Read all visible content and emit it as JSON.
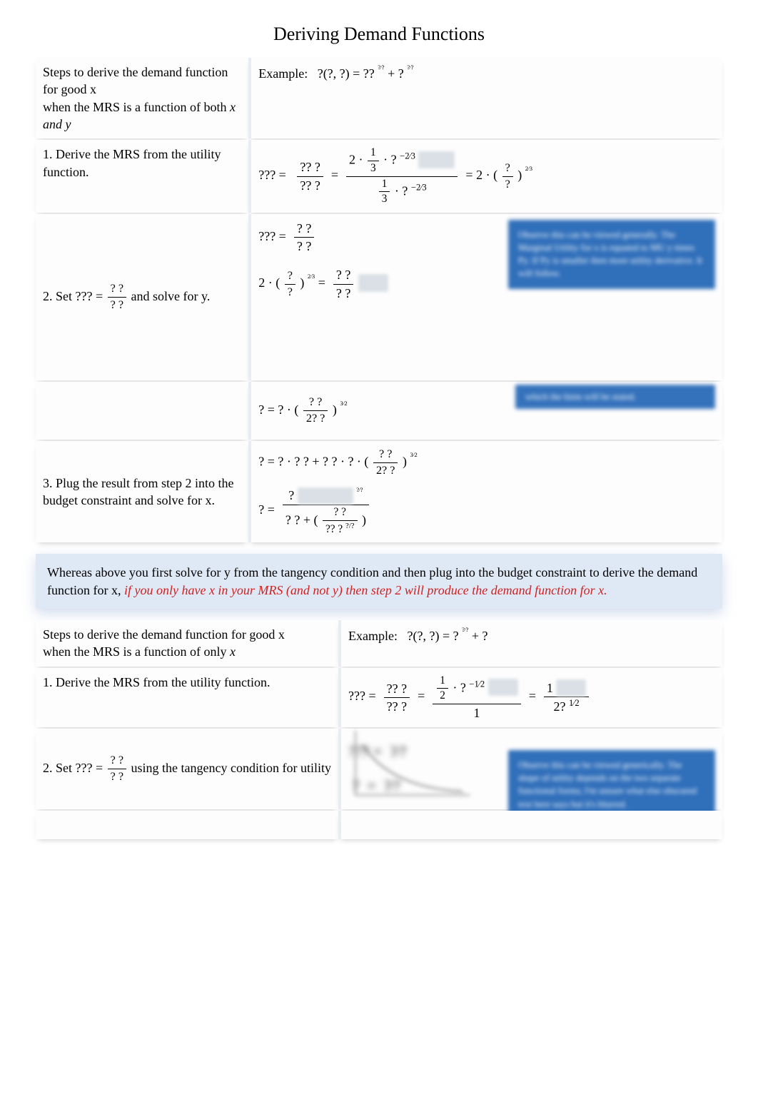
{
  "title": "Deriving Demand Functions",
  "section1": {
    "header_left": "Steps to derive the demand function for good x\nwhen the MRS is a function of both",
    "header_left_vars": " x and y",
    "header_right_label": "Example:",
    "header_right_eq": "?(?, ?) = ??",
    "header_right_exp1": "?⁄?",
    "header_right_plus": " + ?",
    "header_right_exp2": "?⁄?",
    "step1_left": "1. Derive the MRS from the utility function.",
    "step1_eq_lhs": "??? =",
    "step1_frac_num": "?? ?",
    "step1_frac_den": "?? ?",
    "step1_eq_mid": "=",
    "step1_big_num_a": "2 ·",
    "step1_big_num_frac_num": "1",
    "step1_big_num_frac_den": "3",
    "step1_big_num_b": "· ?",
    "step1_big_num_exp": "−2⁄3",
    "step1_big_den_frac_num": "1",
    "step1_big_den_frac_den": "3",
    "step1_big_den_b": "· ?",
    "step1_big_den_exp": "−2⁄3",
    "step1_eq_rhs": "= 2 · (",
    "step1_rhs_frac_num": "?",
    "step1_rhs_frac_den": "?",
    "step1_rhs_close": ")",
    "step1_rhs_exp": "2⁄3",
    "step2_left_a": "2. Set ??? =",
    "step2_left_frac_num": "? ?",
    "step2_left_frac_den": "? ?",
    "step2_left_b": " and solve for y.",
    "step2_r_line1_lhs": "??? =",
    "step2_r_line1_num": "? ?",
    "step2_r_line1_den": "? ?",
    "step2_r_line2_a": "2 · (",
    "step2_r_line2_frac_num": "?",
    "step2_r_line2_frac_den": "?",
    "step2_r_line2_b": ")",
    "step2_r_line2_exp": "2⁄3",
    "step2_r_line2_c": " =",
    "step2_r_line2_rhs_num": "? ?",
    "step2_r_line2_rhs_den": "? ?",
    "hint1": "Observe this can be viewed generally. The Marginal Utility for x is equated to MU y times Py. If Py is smaller then more utility derivative. It will follow.",
    "interm_left": " ",
    "interm_eq_a": "? = ? · (",
    "interm_frac_num": "? ?",
    "interm_frac_den": "2? ?",
    "interm_eq_b": ")",
    "interm_exp": "3⁄2",
    "hint2": "which the hints will be stated.",
    "step3_left": "3. Plug the result from step 2 into the budget constraint and solve for x.",
    "step3_line1_a": "? = ? · ? ? + ? ? · ? · (",
    "step3_line1_frac_num": "? ?",
    "step3_line1_frac_den": "2? ?",
    "step3_line1_b": ")",
    "step3_line1_exp": "3⁄2",
    "step3_line2_a": "? =",
    "step3_line2_big_num": "?",
    "step3_line2_den_a": "? ? + (",
    "step3_line2_den_frac_num": "? ?",
    "step3_line2_den_frac_den": "?? ?",
    "step3_line2_den_expfrac": "?/?",
    "step3_line2_den_b": ")",
    "step3_line2_blur_exp": "?⁄?"
  },
  "banner": {
    "text_a": "Whereas above you first solve for ",
    "text_b": "y from the tangency condition and then plug into the budget constraint to derive the demand function for x, ",
    "text_red": "if you only have x in your MRS (and not y) then step 2 will produce the demand function for x."
  },
  "section2": {
    "header_left": "Steps to derive the demand function for good x\nwhen the MRS is a function of only",
    "header_left_vars": " x",
    "header_right_label": "Example:",
    "header_right_eq": "?(?, ?) = ?",
    "header_right_exp": "?⁄?",
    "header_right_plus": " + ?",
    "step1_left": "1. Derive the MRS from the utility function.",
    "step1_eq_lhs": "??? =",
    "step1_frac_num": "?? ?",
    "step1_frac_den": "?? ?",
    "step1_eq_mid": "=",
    "step1_big_num_frac_num": "1",
    "step1_big_num_frac_den": "2",
    "step1_big_num_b": "· ?",
    "step1_big_num_exp": "−1⁄2",
    "step1_big_den": "1",
    "step1_eq_rhs": "=",
    "step1_rhs_frac_num": "1",
    "step1_rhs_frac_den": "2?",
    "step1_rhs_exp": "1⁄2",
    "step2_left_a": "2. Set ??? =",
    "step2_left_frac_num": "? ?",
    "step2_left_frac_den": "? ?",
    "step2_left_b": " using the tangency condition for utility",
    "hint3": "Observe this can be viewed generically. The shape of utility depends on the two separate functional forms; I'm unsure what else obscured text here says but it's blurred."
  }
}
